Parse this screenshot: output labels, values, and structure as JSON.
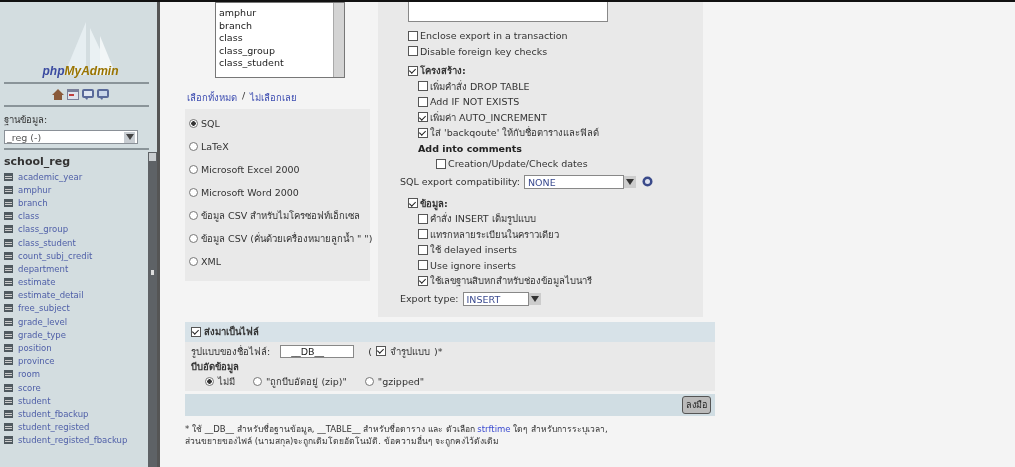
{
  "sidebar": {
    "logo_prefix": "php",
    "logo_suffix": "MyAdmin",
    "database_label": "ฐานข้อมูล:",
    "database_select": "_reg (-)",
    "database_name": "school_reg",
    "tables": [
      "academic_year",
      "amphur",
      "branch",
      "class",
      "class_group",
      "class_student",
      "count_subj_credit",
      "department",
      "estimate",
      "estimate_detail",
      "free_subject",
      "grade_level",
      "grade_type",
      "position",
      "province",
      "room",
      "score",
      "student",
      "student_fbackup",
      "student_registed",
      "student_registed_fbackup"
    ]
  },
  "table_list": [
    "amphur",
    "branch",
    "class",
    "class_group",
    "class_student"
  ],
  "select_links": {
    "all": "เลือกทั้งหมด",
    "separator": "/",
    "none": "ไม่เลือกเลย"
  },
  "formats": [
    {
      "label": "SQL",
      "selected": true
    },
    {
      "label": "LaTeX",
      "selected": false
    },
    {
      "label": "Microsoft Excel 2000",
      "selected": false
    },
    {
      "label": "Microsoft Word 2000",
      "selected": false
    },
    {
      "label": "ข้อมูล CSV สำหรับไมโครซอฟท์เอ็กเซล",
      "selected": false
    },
    {
      "label": "ข้อมูล CSV (คั่นด้วยเครื่องหมายลูกน้ำ \" \")",
      "selected": false
    },
    {
      "label": "XML",
      "selected": false
    }
  ],
  "sql_options": {
    "transaction": [
      {
        "label": "Enclose export in a transaction",
        "checked": false
      },
      {
        "label": "Disable foreign key checks",
        "checked": false
      }
    ],
    "structure": {
      "label": "โครงสร้าง:",
      "checked": true,
      "children": [
        {
          "label": "เพิ่มคำสั่ง DROP TABLE",
          "checked": false
        },
        {
          "label": "Add IF NOT EXISTS",
          "checked": false
        },
        {
          "label": "เพิ่มค่า AUTO_INCREMENT",
          "checked": true
        },
        {
          "label": "ใส่ 'backqoute' ให้กับชื่อตารางและฟิลด์",
          "checked": true
        }
      ],
      "comments_heading": "Add into comments",
      "comments_options": [
        {
          "label": "Creation/Update/Check dates",
          "checked": false
        }
      ]
    },
    "compatibility": {
      "label": "SQL export compatibility:",
      "value": "NONE"
    },
    "data": {
      "label": "ข้อมูล:",
      "checked": true,
      "children": [
        {
          "label": "คำสั่ง INSERT เต็มรูปแบบ",
          "checked": false
        },
        {
          "label": "แทรกหลายระเบียนในคราวเดียว",
          "checked": false
        },
        {
          "label": "ใช้ delayed inserts",
          "checked": false
        },
        {
          "label": "Use ignore inserts",
          "checked": false
        },
        {
          "label": "ใช้เลขฐานสิบหกสำหรับช่องข้อมูลไบนารี",
          "checked": true
        }
      ]
    },
    "export_type": {
      "label": "Export type:",
      "value": "INSERT"
    }
  },
  "save_file": {
    "label": "ส่งมาเป็นไฟล์",
    "checked": true,
    "filename_label": "รูปแบบของชื่อไฟล์:",
    "filename_value": "__DB__",
    "remember_open": "(",
    "remember_label": "จำรูปแบบ",
    "remember_checked": true,
    "remember_close": ")*",
    "compression_label": "บีบอัดข้อมูล",
    "compression": [
      {
        "label": "ไม่มี",
        "selected": true
      },
      {
        "label": "\"ถูกบีบอัดอยู่ (zip)\"",
        "selected": false
      },
      {
        "label": "\"gzipped\"",
        "selected": false
      }
    ]
  },
  "go_button": "ลงมือ",
  "footnote": {
    "before": "* ใช้ __DB__ สำหรับชื่อฐานข้อมูล, __TABLE__ สำหรับชื่อตาราง และ ตัวเลือก",
    "link": "strftime",
    "after": "ใดๆ สำหรับการระบุเวลา,",
    "line_2": "ส่วนขยายของไฟล์ (นามสกุล)จะถูกเติมโดยอัตโนมัติ. ข้อความอื่นๆ จะถูกคงไว้ดังเดิม"
  }
}
